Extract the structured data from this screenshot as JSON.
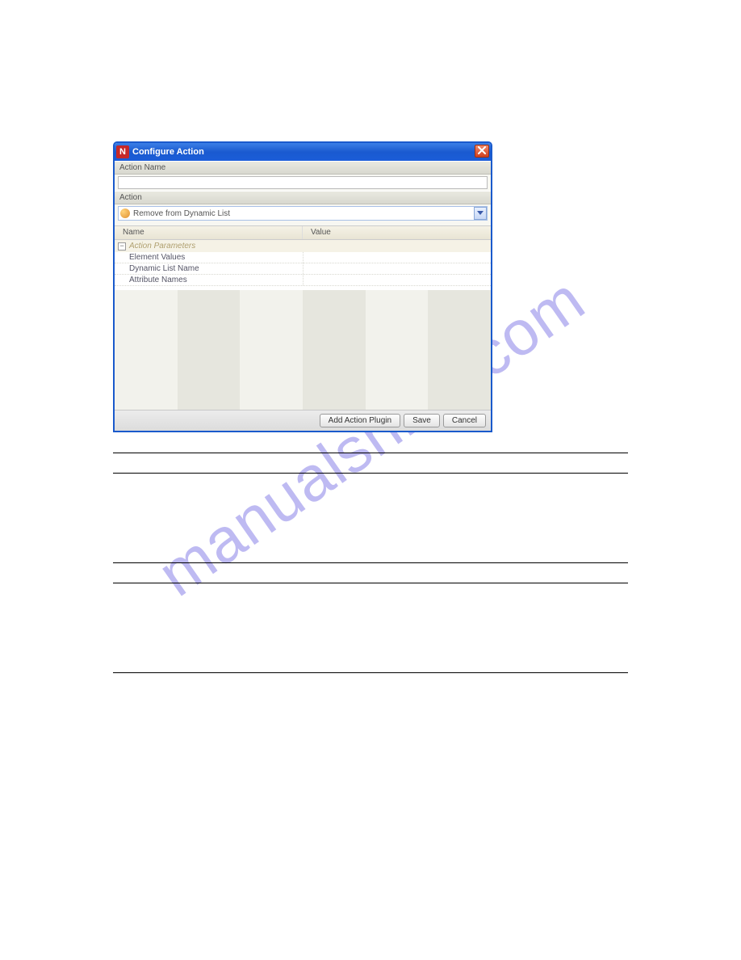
{
  "dialog": {
    "title": "Configure Action",
    "action_name_label": "Action Name",
    "action_name_value": "",
    "action_label": "Action",
    "action_dropdown_value": "Remove from Dynamic List",
    "grid": {
      "col_name": "Name",
      "col_value": "Value",
      "group_header": "Action Parameters",
      "rows": [
        {
          "name": "Element Values",
          "value": ""
        },
        {
          "name": "Dynamic List Name",
          "value": ""
        },
        {
          "name": "Attribute Names",
          "value": ""
        }
      ]
    },
    "buttons": {
      "add_plugin": "Add Action Plugin",
      "save": "Save",
      "cancel": "Cancel"
    }
  },
  "doc": {
    "row1_label": "",
    "row1_desc": "",
    "row2_label": "",
    "row2_desc": ""
  },
  "watermark": "manualshive.com"
}
